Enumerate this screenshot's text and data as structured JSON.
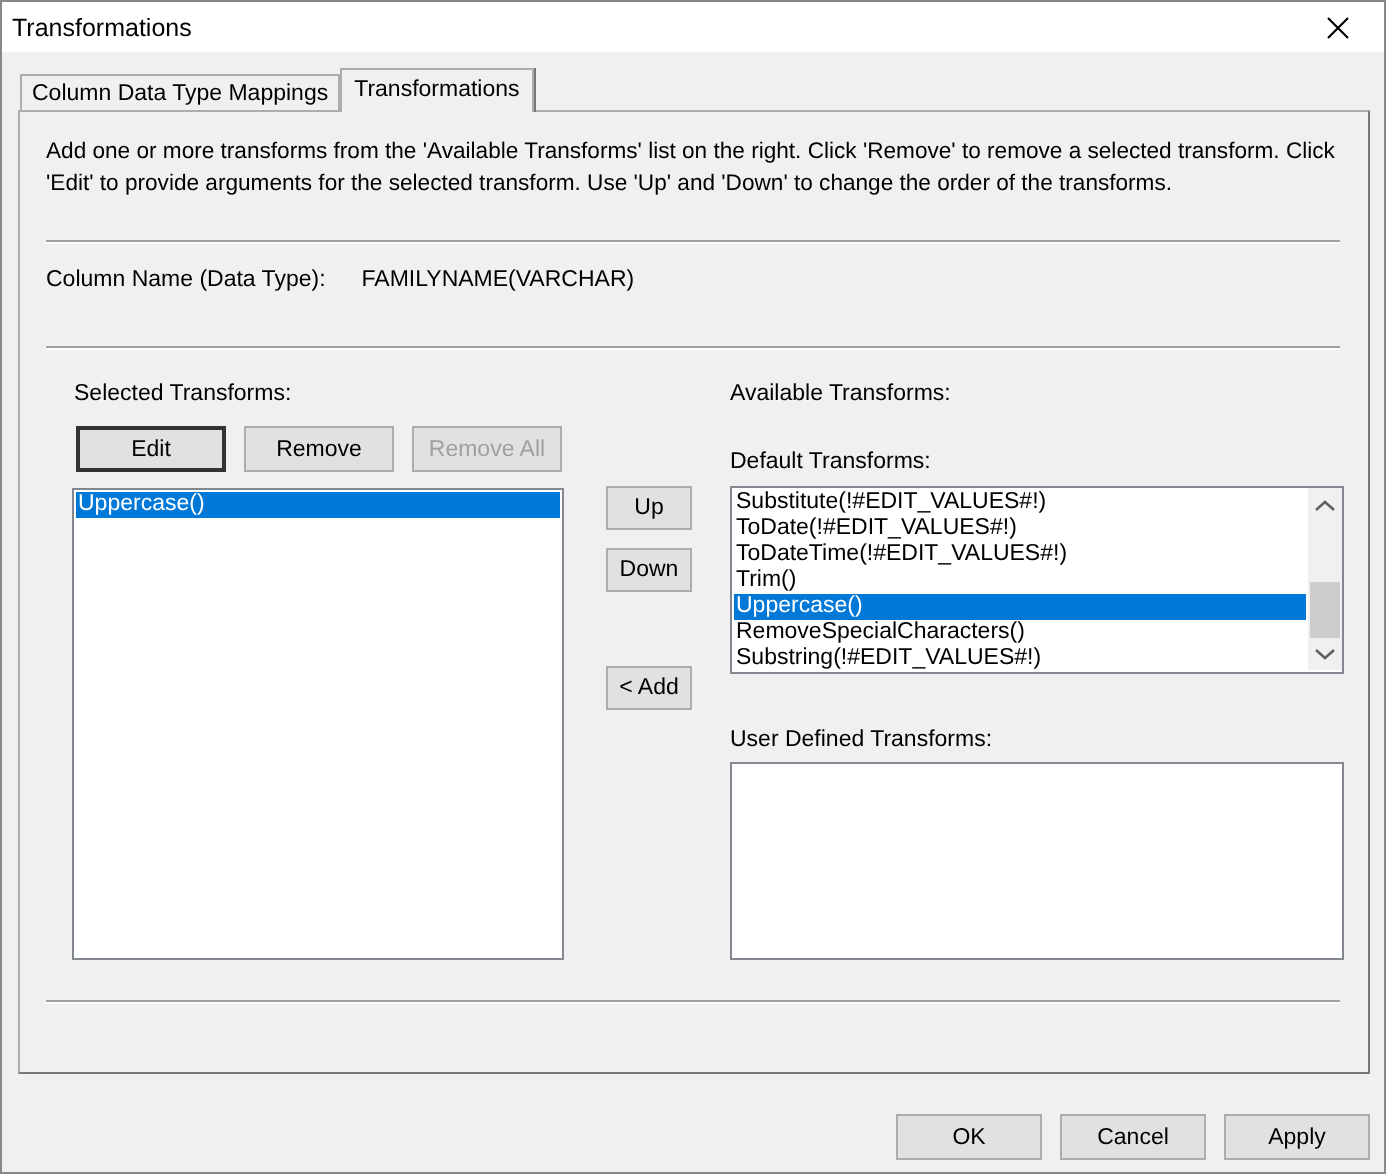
{
  "window": {
    "title": "Transformations"
  },
  "tabs": [
    {
      "label": "Column Data Type Mappings",
      "selected": false
    },
    {
      "label": "Transformations",
      "selected": true
    }
  ],
  "description": "Add one or more transforms from the 'Available Transforms' list on the right. Click 'Remove' to remove a selected transform. Click 'Edit' to provide arguments for the selected transform. Use 'Up' and 'Down' to change the order of the transforms.",
  "column_name": {
    "label": "Column Name (Data Type):",
    "value": "FAMILYNAME(VARCHAR)"
  },
  "selected_transforms": {
    "label": "Selected Transforms:",
    "buttons": [
      {
        "label": "Edit",
        "disabled": false,
        "default": true
      },
      {
        "label": "Remove",
        "disabled": false,
        "default": false
      },
      {
        "label": "Remove All",
        "disabled": true,
        "default": false
      }
    ],
    "items": [
      {
        "label": "Uppercase()",
        "selected": true
      }
    ]
  },
  "order_buttons": [
    {
      "label": "Up",
      "disabled": false
    },
    {
      "label": "Down",
      "disabled": false
    }
  ],
  "add_button": {
    "label": "< Add",
    "disabled": false
  },
  "available_transforms": {
    "label": "Available Transforms:",
    "default_label": "Default Transforms:",
    "default_items": [
      {
        "label": "Substitute(!#EDIT_VALUES#!)",
        "selected": false
      },
      {
        "label": "ToDate(!#EDIT_VALUES#!)",
        "selected": false
      },
      {
        "label": "ToDateTime(!#EDIT_VALUES#!)",
        "selected": false
      },
      {
        "label": "Trim()",
        "selected": false
      },
      {
        "label": "Uppercase()",
        "selected": true
      },
      {
        "label": "RemoveSpecialCharacters()",
        "selected": false
      },
      {
        "label": "Substring(!#EDIT_VALUES#!)",
        "selected": false
      }
    ],
    "user_defined_label": "User Defined Transforms:"
  },
  "footer_buttons": [
    {
      "label": "OK",
      "disabled": false
    },
    {
      "label": "Cancel",
      "disabled": false
    },
    {
      "label": "Apply",
      "disabled": false
    }
  ]
}
